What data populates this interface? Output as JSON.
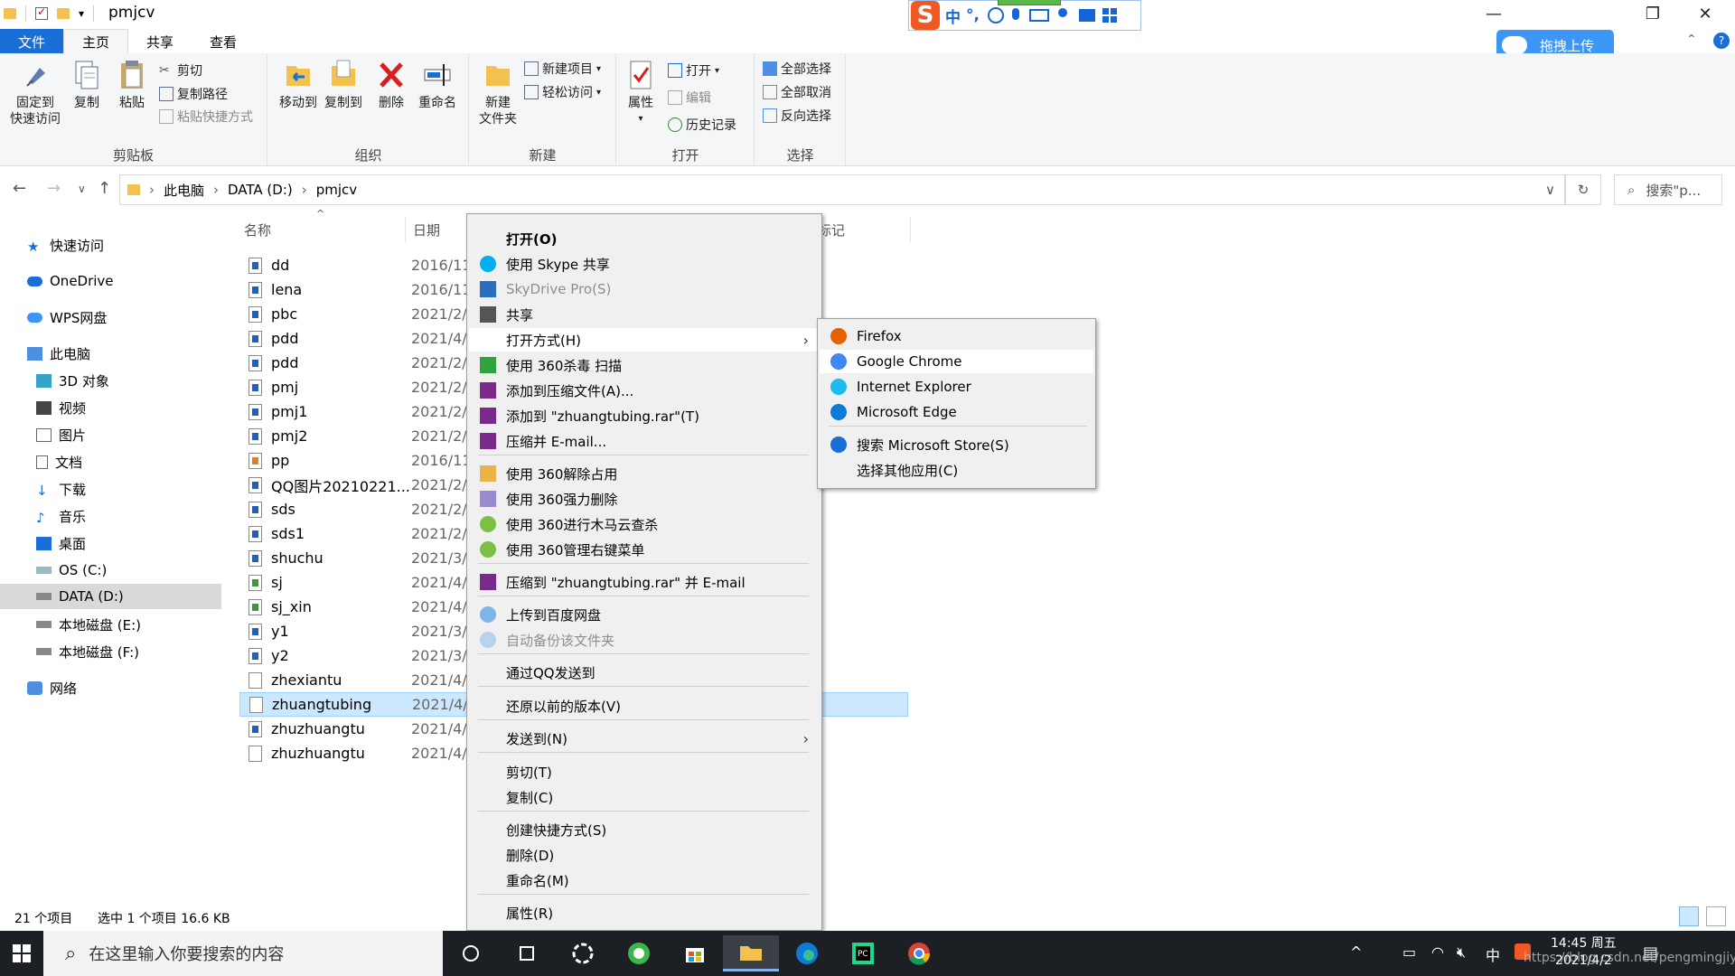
{
  "window": {
    "title": "pmjcv",
    "quick_access_dropdown": "▾"
  },
  "ime": {
    "chars": [
      "中",
      "°,"
    ]
  },
  "ribbon_tabs": [
    "文件",
    "主页",
    "共享",
    "查看"
  ],
  "upload_button": "拖拽上传",
  "ribbon": {
    "clipboard": {
      "label": "剪贴板",
      "pin": "固定到\n快速访问",
      "copy": "复制",
      "paste": "粘贴",
      "cut": "剪切",
      "copy_path": "复制路径",
      "paste_shortcut": "粘贴快捷方式"
    },
    "organize": {
      "label": "组织",
      "move_to": "移动到",
      "copy_to": "复制到",
      "delete": "删除",
      "rename": "重命名"
    },
    "new": {
      "label": "新建",
      "new_folder": "新建\n文件夹",
      "new_item": "新建项目",
      "easy_access": "轻松访问"
    },
    "open": {
      "label": "打开",
      "properties": "属性",
      "open": "打开",
      "edit": "编辑",
      "history": "历史记录"
    },
    "select": {
      "label": "选择",
      "select_all": "全部选择",
      "select_none": "全部取消",
      "invert": "反向选择"
    }
  },
  "address": {
    "crumbs": [
      "此电脑",
      "DATA (D:)",
      "pmjcv"
    ],
    "search_placeholder": "搜索\"p..."
  },
  "nav": {
    "quick_access": "快速访问",
    "onedrive": "OneDrive",
    "wps": "WPS网盘",
    "this_pc": "此电脑",
    "objects3d": "3D 对象",
    "videos": "视频",
    "pictures": "图片",
    "documents": "文档",
    "downloads": "下载",
    "music": "音乐",
    "desktop": "桌面",
    "drive_c": "OS (C:)",
    "drive_d": "DATA (D:)",
    "drive_e": "本地磁盘 (E:)",
    "drive_f": "本地磁盘 (F:)",
    "network": "网络"
  },
  "columns": {
    "name": "名称",
    "date": "日期",
    "tags": "标记"
  },
  "files": [
    {
      "name": "dd",
      "date": "2016/11"
    },
    {
      "name": "lena",
      "date": "2016/11"
    },
    {
      "name": "pbc",
      "date": "2021/2/"
    },
    {
      "name": "pdd",
      "date": "2021/4/"
    },
    {
      "name": "pdd",
      "date": "2021/2/"
    },
    {
      "name": "pmj",
      "date": "2021/2/"
    },
    {
      "name": "pmj1",
      "date": "2021/2/"
    },
    {
      "name": "pmj2",
      "date": "2021/2/"
    },
    {
      "name": "pp",
      "date": "2016/11"
    },
    {
      "name": "QQ图片20210221...",
      "date": "2021/2/"
    },
    {
      "name": "sds",
      "date": "2021/2/"
    },
    {
      "name": "sds1",
      "date": "2021/2/"
    },
    {
      "name": "shuchu",
      "date": "2021/3/"
    },
    {
      "name": "sj",
      "date": "2021/4/"
    },
    {
      "name": "sj_xin",
      "date": "2021/4/"
    },
    {
      "name": "y1",
      "date": "2021/3/"
    },
    {
      "name": "y2",
      "date": "2021/3/"
    },
    {
      "name": "zhexiantu",
      "date": "2021/4/"
    },
    {
      "name": "zhuangtubing",
      "date": "2021/4/"
    },
    {
      "name": "zhuzhuangtu",
      "date": "2021/4/"
    },
    {
      "name": "zhuzhuangtu",
      "date": "2021/4/"
    }
  ],
  "context_menu": {
    "open": "打开(O)",
    "skype": "使用 Skype 共享",
    "skydrive": "SkyDrive Pro(S)",
    "share": "共享",
    "open_with": "打开方式(H)",
    "scan360": "使用 360杀毒 扫描",
    "add_archive": "添加到压缩文件(A)...",
    "add_rar": "添加到 \"zhuangtubing.rar\"(T)",
    "compress_email": "压缩并 E-mail...",
    "unlock360": "使用 360解除占用",
    "shred360": "使用 360强力删除",
    "trojan360": "使用 360进行木马云查杀",
    "manage360": "使用 360管理右键菜单",
    "compress_rar_email": "压缩到 \"zhuangtubing.rar\" 并 E-mail",
    "baidu_upload": "上传到百度网盘",
    "baidu_backup": "自动备份该文件夹",
    "send_qq": "通过QQ发送到",
    "restore": "还原以前的版本(V)",
    "send_to": "发送到(N)",
    "cut": "剪切(T)",
    "copy": "复制(C)",
    "create_shortcut": "创建快捷方式(S)",
    "delete": "删除(D)",
    "rename": "重命名(M)",
    "properties": "属性(R)"
  },
  "open_with_menu": {
    "firefox": "Firefox",
    "chrome": "Google Chrome",
    "ie": "Internet Explorer",
    "edge": "Microsoft Edge",
    "store": "搜索 Microsoft Store(S)",
    "other": "选择其他应用(C)"
  },
  "status": {
    "count": "21 个项目",
    "selection": "选中 1 个项目  16.6 KB"
  },
  "taskbar": {
    "search_placeholder": "在这里输入你要搜索的内容",
    "ime_char": "中",
    "time": "14:45 周五",
    "date": "2021/4/2"
  },
  "watermark": "https://blog.csdn.net/pengmingjiy",
  "colors": {
    "accent": "#1a6ed8",
    "selection": "#cce8ff",
    "taskbar": "#1c2024",
    "menu_bg": "#f0f0f0"
  }
}
